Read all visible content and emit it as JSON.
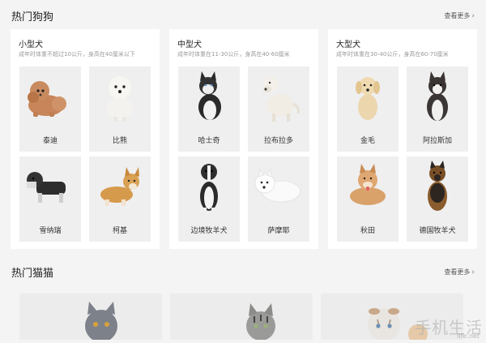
{
  "dogs_section": {
    "title": "热门狗狗",
    "more_label": "查看更多",
    "panels": [
      {
        "title": "小型犬",
        "desc": "成年时体重不超过10公斤，身高在40厘米以下",
        "breeds": [
          "泰迪",
          "比熊",
          "雪纳瑞",
          "柯基"
        ]
      },
      {
        "title": "中型犬",
        "desc": "成年时体重在11-30公斤，身高在40-60厘米",
        "breeds": [
          "哈士奇",
          "拉布拉多",
          "边境牧羊犬",
          "萨摩耶"
        ]
      },
      {
        "title": "大型犬",
        "desc": "成年时体重在30-40公斤，身高在60-70厘米",
        "breeds": [
          "金毛",
          "阿拉斯加",
          "秋田",
          "德国牧羊犬"
        ]
      }
    ]
  },
  "cats_section": {
    "title": "热门猫猫",
    "more_label": "查看更多"
  },
  "watermark": {
    "text": "手机生活",
    "sub": "life.net"
  }
}
